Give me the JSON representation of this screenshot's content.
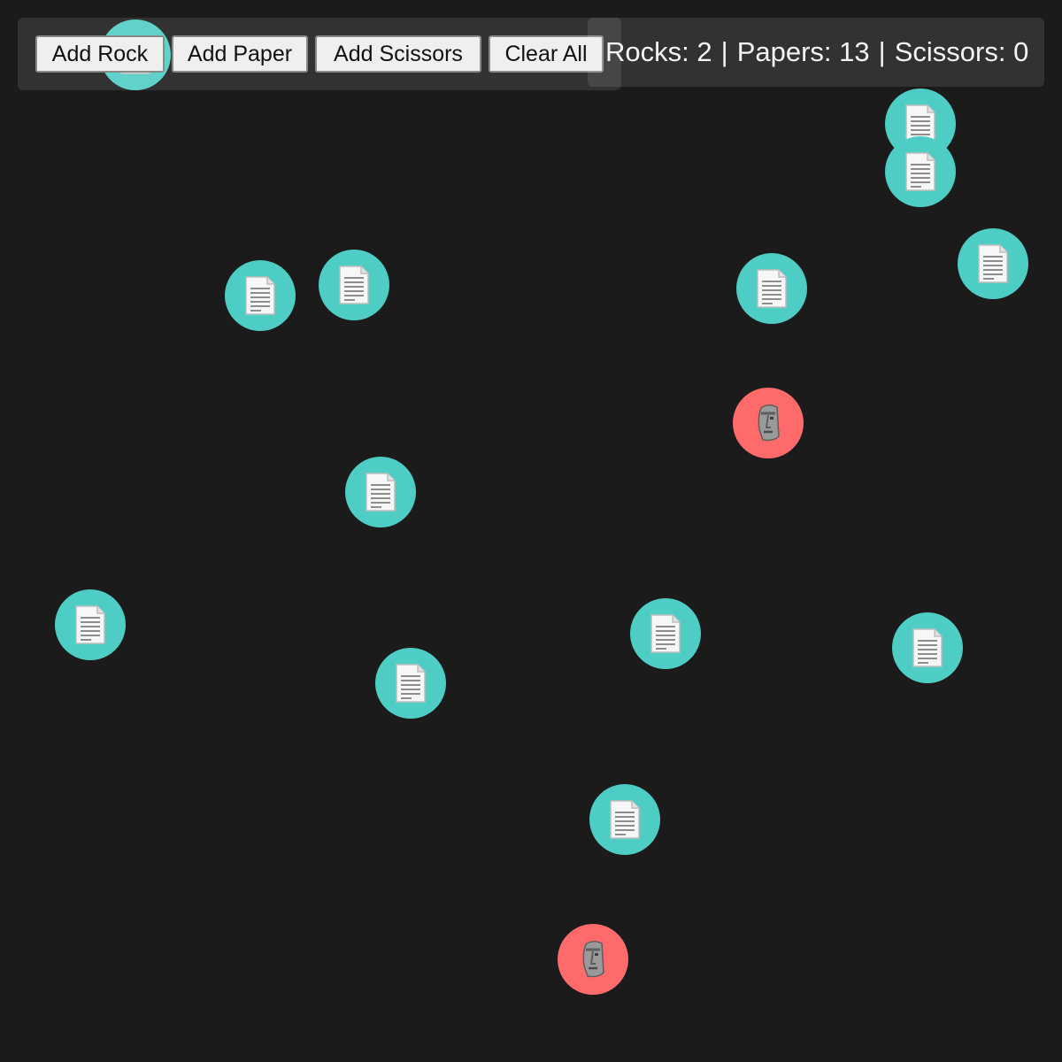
{
  "controls": {
    "add_rock_label": "Add Rock",
    "add_paper_label": "Add Paper",
    "add_scissors_label": "Add Scissors",
    "clear_all_label": "Clear All"
  },
  "stats": {
    "rocks_label": "Rocks:",
    "rocks_count": "2",
    "papers_label": "Papers:",
    "papers_count": "13",
    "scissors_label": "Scissors:",
    "scissors_count": "0",
    "separator": "|"
  },
  "colors": {
    "background": "#1b1b1b",
    "paper": "#4ecdc4",
    "rock": "#ff6b6b",
    "scissors": "#ffe66d"
  },
  "entities": [
    {
      "type": "paper",
      "icon": "page-icon"
    },
    {
      "type": "paper",
      "icon": "page-icon"
    },
    {
      "type": "paper",
      "icon": "page-icon"
    },
    {
      "type": "paper",
      "icon": "page-icon"
    },
    {
      "type": "paper",
      "icon": "page-icon"
    },
    {
      "type": "paper",
      "icon": "page-icon"
    },
    {
      "type": "paper",
      "icon": "page-icon"
    },
    {
      "type": "paper",
      "icon": "page-icon"
    },
    {
      "type": "paper",
      "icon": "page-icon"
    },
    {
      "type": "paper",
      "icon": "page-icon"
    },
    {
      "type": "paper",
      "icon": "page-icon"
    },
    {
      "type": "paper",
      "icon": "page-icon"
    },
    {
      "type": "paper",
      "icon": "page-icon"
    },
    {
      "type": "rock",
      "icon": "moai-icon"
    },
    {
      "type": "rock",
      "icon": "moai-icon"
    }
  ]
}
